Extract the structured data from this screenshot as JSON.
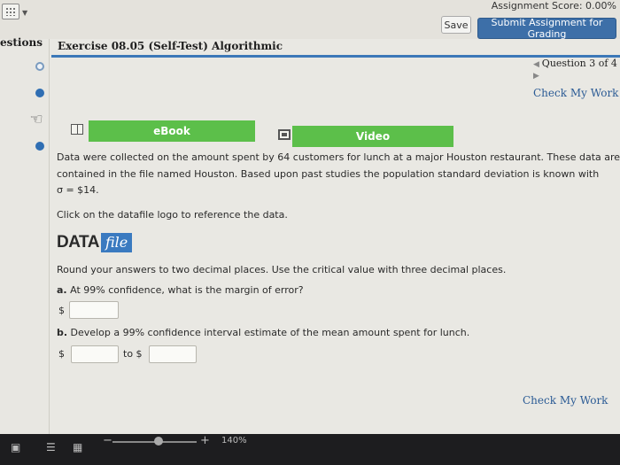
{
  "header": {
    "assignment_score": "Assignment Score: 0.00%",
    "save_label": "Save",
    "submit_label": "Submit Assignment for Grading"
  },
  "sidebar": {
    "label": "estions"
  },
  "exercise": {
    "title": "Exercise 08.05 (Self-Test) Algorithmic",
    "question_nav": "Question 3 of 4",
    "check_top": "Check My Work",
    "check_bottom": "Check My Work"
  },
  "resources": {
    "ebook": "eBook",
    "video": "Video"
  },
  "problem": {
    "line1": "Data were collected on the amount spent by 64 customers for lunch at a major Houston restaurant. These data are",
    "line2": "contained in the file named Houston. Based upon past studies the population standard deviation is known with",
    "line3": "σ = $14.",
    "click_note": "Click on the datafile logo to reference the data.",
    "datafile_data": "DATA",
    "datafile_file": "file",
    "round_note": "Round your answers to two decimal places. Use the critical value with three decimal places.",
    "qa_letter": "a.",
    "qa_text": " At 99% confidence, what is the margin of error?",
    "qb_letter": "b.",
    "qb_text": " Develop a 99% confidence interval estimate of the mean amount spent for lunch.",
    "dollar": "$",
    "to_label": "to $"
  },
  "taskbar": {
    "zoom": "140%",
    "minus": "−",
    "plus": "+"
  },
  "colors": {
    "accent": "#3d6fa8",
    "resource_green": "#5cbf4a",
    "title_rule": "#3c78b8"
  }
}
